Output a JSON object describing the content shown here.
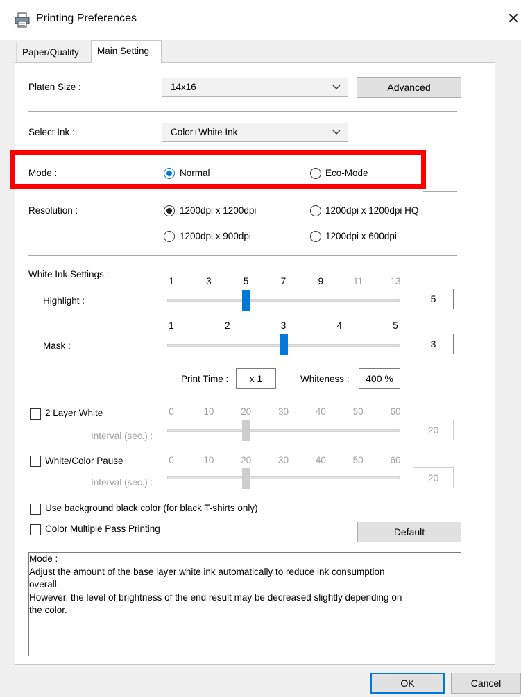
{
  "window": {
    "title": "Printing Preferences",
    "close_glyph": "✕",
    "icon": "printer-icon"
  },
  "tabs": [
    {
      "label": "Paper/Quality",
      "active": false
    },
    {
      "label": "Main Setting",
      "active": true
    }
  ],
  "platen": {
    "label": "Platen Size :",
    "value": "14x16",
    "advanced_label": "Advanced"
  },
  "ink": {
    "label": "Select Ink :",
    "value": "Color+White Ink"
  },
  "mode": {
    "label": "Mode :",
    "options": [
      {
        "label": "Normal",
        "selected": true
      },
      {
        "label": "Eco-Mode",
        "selected": false
      }
    ]
  },
  "resolution": {
    "label": "Resolution :",
    "options": [
      {
        "label": "1200dpi x 1200dpi",
        "selected": true
      },
      {
        "label": "1200dpi x 1200dpi HQ",
        "selected": false
      },
      {
        "label": "1200dpi x 900dpi",
        "selected": false
      },
      {
        "label": "1200dpi x 600dpi",
        "selected": false
      }
    ]
  },
  "white_ink": {
    "label": "White Ink Settings :",
    "highlight": {
      "label": "Highlight :",
      "ticks": [
        "1",
        "3",
        "5",
        "7",
        "9",
        "11",
        "13"
      ],
      "value": "5",
      "position": 0.3333
    },
    "mask": {
      "label": "Mask :",
      "ticks": [
        "1",
        "2",
        "3",
        "4",
        "5"
      ],
      "value": "3",
      "position": 0.5
    },
    "print_time_label": "Print Time :",
    "print_time_value": "x 1",
    "whiteness_label": "Whiteness :",
    "whiteness_value": "400 %"
  },
  "two_layer": {
    "label": "2 Layer White",
    "checked": false,
    "interval_label": "Interval (sec.) :",
    "ticks": [
      "0",
      "10",
      "20",
      "30",
      "40",
      "50",
      "60"
    ],
    "value": "20",
    "position": 0.3333
  },
  "pause": {
    "label": "White/Color Pause",
    "checked": false,
    "interval_label": "Interval (sec.) :",
    "ticks": [
      "0",
      "10",
      "20",
      "30",
      "40",
      "50",
      "60"
    ],
    "value": "20",
    "position": 0.3333
  },
  "options": {
    "black_bg_label": "Use background black color (for black T-shirts only)",
    "multi_pass_label": "Color Multiple Pass Printing",
    "default_label": "Default"
  },
  "description": {
    "lines": [
      "Mode :",
      "Adjust the amount of the base layer white ink automatically to reduce ink consumption",
      "overall.",
      "However, the level of brightness of the end result may be decreased slightly depending on",
      "the color."
    ]
  },
  "footer": {
    "ok_label": "OK",
    "cancel_label": "Cancel"
  },
  "colors": {
    "accent": "#0078d7",
    "highlight_frame": "#ff0000"
  }
}
